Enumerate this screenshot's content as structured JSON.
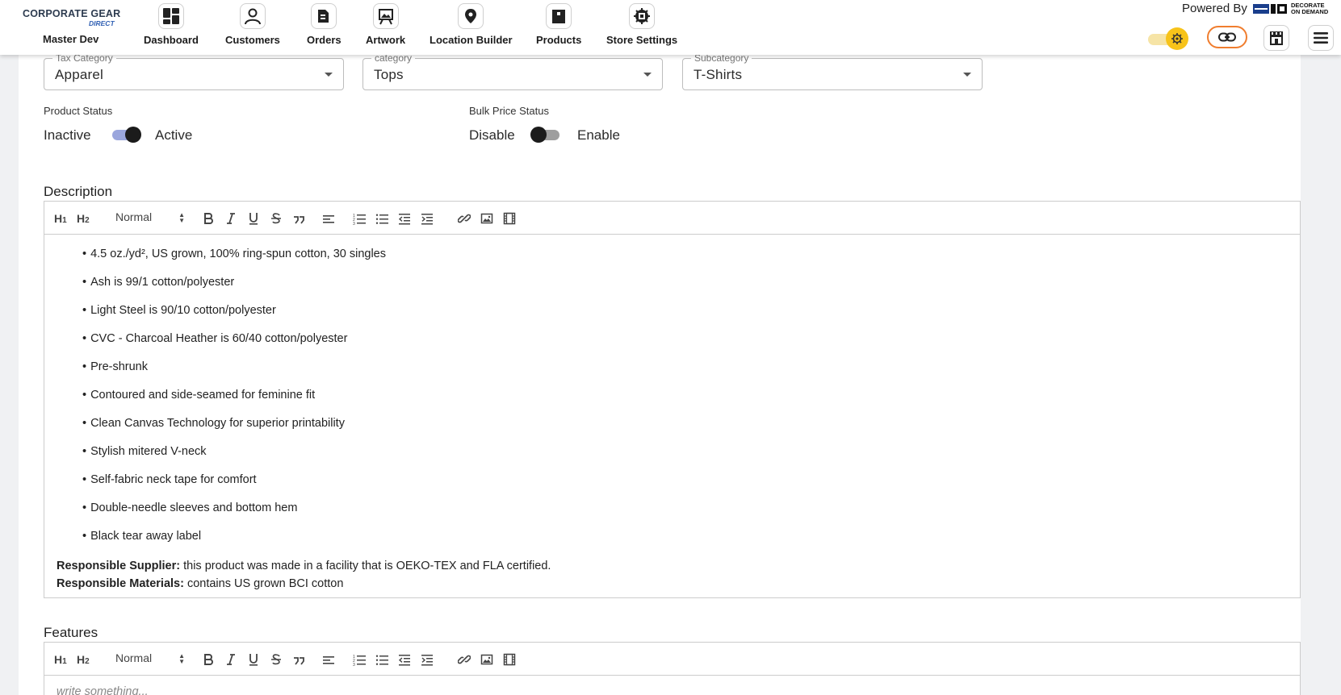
{
  "brand": {
    "logo_text": "CORPORATE GEAR",
    "logo_sub": "DIRECT",
    "user": "Master Dev"
  },
  "nav": {
    "items": [
      {
        "label": "Dashboard",
        "icon": "dashboard-icon"
      },
      {
        "label": "Customers",
        "icon": "user-icon"
      },
      {
        "label": "Orders",
        "icon": "orders-icon"
      },
      {
        "label": "Artwork",
        "icon": "artwork-icon"
      },
      {
        "label": "Location Builder",
        "icon": "location-pin-icon"
      },
      {
        "label": "Products",
        "icon": "box-icon"
      },
      {
        "label": "Store Settings",
        "icon": "settings-chip-icon"
      }
    ]
  },
  "header_right": {
    "powered_by": "Powered By",
    "powered_brand_line1": "DECORATE",
    "powered_brand_line2": "ON DEMAND",
    "theme_icon": "gear-icon",
    "link_icon": "link-icon",
    "store_icon": "storefront-icon",
    "menu_icon": "hamburger-menu-icon",
    "accent_orange": "#f07d2e",
    "accent_yellow": "#f7c31a"
  },
  "form": {
    "tax_category": {
      "label": "Tax Category",
      "value": "Apparel"
    },
    "category": {
      "label": "category",
      "value": "Tops"
    },
    "subcategory": {
      "label": "Subcategory",
      "value": "T-Shirts"
    },
    "product_status": {
      "label": "Product Status",
      "off_text": "Inactive",
      "on_text": "Active",
      "enabled": true
    },
    "bulk_price_status": {
      "label": "Bulk Price Status",
      "off_text": "Disable",
      "on_text": "Enable",
      "enabled": false
    }
  },
  "toolbar": {
    "h1": "H",
    "h1_sub": "1",
    "h2": "H",
    "h2_sub": "2",
    "format": "Normal"
  },
  "description": {
    "title": "Description",
    "bullets": [
      "4.5 oz./yd², US grown, 100% ring-spun cotton, 30 singles",
      "Ash is 99/1 cotton/polyester",
      "Light Steel is 90/10 cotton/polyester",
      "CVC - Charcoal Heather is 60/40 cotton/polyester",
      "Pre-shrunk",
      "Contoured and side-seamed for feminine fit",
      "Clean Canvas Technology for superior printability",
      "Stylish mitered V-neck",
      "Self-fabric neck tape for comfort",
      "Double-needle sleeves and bottom hem",
      "Black tear away label"
    ],
    "supplier_label": "Responsible Supplier:",
    "supplier_text": " this product was made in a facility that is OEKO-TEX and FLA certified.",
    "materials_label": "Responsible Materials:",
    "materials_text": " contains US grown BCI cotton"
  },
  "features": {
    "title": "Features",
    "placeholder": "write something..."
  }
}
